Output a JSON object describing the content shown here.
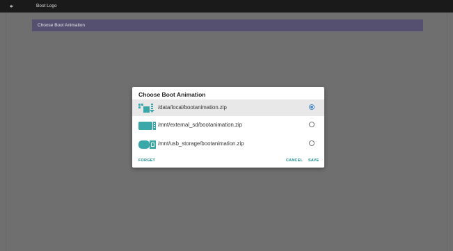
{
  "topbar": {
    "title": "Boot Logo",
    "back_icon": "arrow-left-icon"
  },
  "subheader": {
    "label": "Choose Boot Animation"
  },
  "dialog": {
    "title": "Choose Boot Animation",
    "options": [
      {
        "label": "/data/local/bootanimation.zip",
        "icon": "internal-storage-icon",
        "selected": true
      },
      {
        "label": "/mnt/external_sd/bootanimation.zip",
        "icon": "sd-card-icon",
        "selected": false
      },
      {
        "label": "/mnt/usb_storage/bootanimation.zip",
        "icon": "usb-storage-icon",
        "selected": false
      }
    ],
    "buttons": {
      "forget": "FORGET",
      "cancel": "CANCEL",
      "save": "SAVE"
    }
  },
  "colors": {
    "accent": "#1b8a8a",
    "radio": "#4a86c9",
    "subheader": "#55506f",
    "topbar": "#1a1a1a"
  }
}
